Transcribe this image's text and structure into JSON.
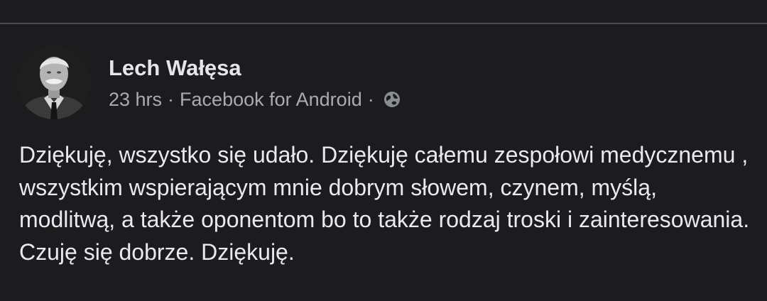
{
  "post": {
    "author": "Lech Wałęsa",
    "time": "23 hrs",
    "separator": "·",
    "source": "Facebook for Android",
    "privacy_icon": "globe-icon",
    "body": "Dziękuję, wszystko się udało. Dziękuję całemu zespołowi medycznemu , wszystkim wspierającym mnie dobrym słowem, czynem, myślą, modlitwą, a także oponentom bo to także rodzaj troski i zainteresowania. Czuję się dobrze. Dziękuję."
  },
  "colors": {
    "background": "#1c1c1e",
    "primary_text": "#e4e6eb",
    "secondary_text": "#a8abb0",
    "divider": "#4a4a4d"
  }
}
